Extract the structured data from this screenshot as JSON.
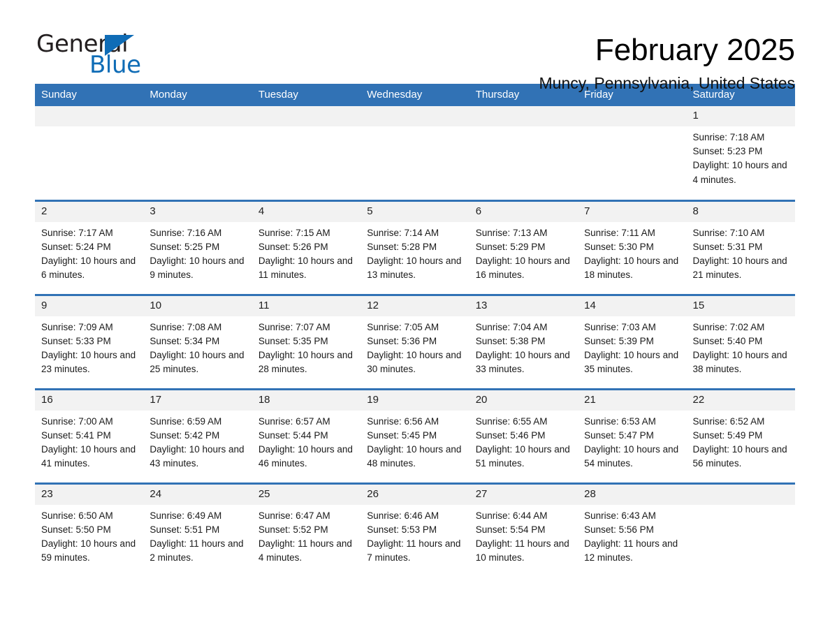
{
  "brand": {
    "name_part1": "General",
    "name_part2": "Blue",
    "accent_color": "#0f6cb6"
  },
  "header": {
    "month_title": "February 2025",
    "location": "Muncy, Pennsylvania, United States"
  },
  "theme": {
    "header_blue": "#3172b5",
    "daynum_band": "#f2f2f2",
    "text": "#1a1a1a"
  },
  "weekdays": [
    "Sunday",
    "Monday",
    "Tuesday",
    "Wednesday",
    "Thursday",
    "Friday",
    "Saturday"
  ],
  "labels": {
    "sunrise": "Sunrise:",
    "sunset": "Sunset:",
    "daylight": "Daylight:"
  },
  "weeks": [
    [
      {
        "day": ""
      },
      {
        "day": ""
      },
      {
        "day": ""
      },
      {
        "day": ""
      },
      {
        "day": ""
      },
      {
        "day": ""
      },
      {
        "day": "1",
        "sunrise": "Sunrise: 7:18 AM",
        "sunset": "Sunset: 5:23 PM",
        "daylight": "Daylight: 10 hours and 4 minutes."
      }
    ],
    [
      {
        "day": "2",
        "sunrise": "Sunrise: 7:17 AM",
        "sunset": "Sunset: 5:24 PM",
        "daylight": "Daylight: 10 hours and 6 minutes."
      },
      {
        "day": "3",
        "sunrise": "Sunrise: 7:16 AM",
        "sunset": "Sunset: 5:25 PM",
        "daylight": "Daylight: 10 hours and 9 minutes."
      },
      {
        "day": "4",
        "sunrise": "Sunrise: 7:15 AM",
        "sunset": "Sunset: 5:26 PM",
        "daylight": "Daylight: 10 hours and 11 minutes."
      },
      {
        "day": "5",
        "sunrise": "Sunrise: 7:14 AM",
        "sunset": "Sunset: 5:28 PM",
        "daylight": "Daylight: 10 hours and 13 minutes."
      },
      {
        "day": "6",
        "sunrise": "Sunrise: 7:13 AM",
        "sunset": "Sunset: 5:29 PM",
        "daylight": "Daylight: 10 hours and 16 minutes."
      },
      {
        "day": "7",
        "sunrise": "Sunrise: 7:11 AM",
        "sunset": "Sunset: 5:30 PM",
        "daylight": "Daylight: 10 hours and 18 minutes."
      },
      {
        "day": "8",
        "sunrise": "Sunrise: 7:10 AM",
        "sunset": "Sunset: 5:31 PM",
        "daylight": "Daylight: 10 hours and 21 minutes."
      }
    ],
    [
      {
        "day": "9",
        "sunrise": "Sunrise: 7:09 AM",
        "sunset": "Sunset: 5:33 PM",
        "daylight": "Daylight: 10 hours and 23 minutes."
      },
      {
        "day": "10",
        "sunrise": "Sunrise: 7:08 AM",
        "sunset": "Sunset: 5:34 PM",
        "daylight": "Daylight: 10 hours and 25 minutes."
      },
      {
        "day": "11",
        "sunrise": "Sunrise: 7:07 AM",
        "sunset": "Sunset: 5:35 PM",
        "daylight": "Daylight: 10 hours and 28 minutes."
      },
      {
        "day": "12",
        "sunrise": "Sunrise: 7:05 AM",
        "sunset": "Sunset: 5:36 PM",
        "daylight": "Daylight: 10 hours and 30 minutes."
      },
      {
        "day": "13",
        "sunrise": "Sunrise: 7:04 AM",
        "sunset": "Sunset: 5:38 PM",
        "daylight": "Daylight: 10 hours and 33 minutes."
      },
      {
        "day": "14",
        "sunrise": "Sunrise: 7:03 AM",
        "sunset": "Sunset: 5:39 PM",
        "daylight": "Daylight: 10 hours and 35 minutes."
      },
      {
        "day": "15",
        "sunrise": "Sunrise: 7:02 AM",
        "sunset": "Sunset: 5:40 PM",
        "daylight": "Daylight: 10 hours and 38 minutes."
      }
    ],
    [
      {
        "day": "16",
        "sunrise": "Sunrise: 7:00 AM",
        "sunset": "Sunset: 5:41 PM",
        "daylight": "Daylight: 10 hours and 41 minutes."
      },
      {
        "day": "17",
        "sunrise": "Sunrise: 6:59 AM",
        "sunset": "Sunset: 5:42 PM",
        "daylight": "Daylight: 10 hours and 43 minutes."
      },
      {
        "day": "18",
        "sunrise": "Sunrise: 6:57 AM",
        "sunset": "Sunset: 5:44 PM",
        "daylight": "Daylight: 10 hours and 46 minutes."
      },
      {
        "day": "19",
        "sunrise": "Sunrise: 6:56 AM",
        "sunset": "Sunset: 5:45 PM",
        "daylight": "Daylight: 10 hours and 48 minutes."
      },
      {
        "day": "20",
        "sunrise": "Sunrise: 6:55 AM",
        "sunset": "Sunset: 5:46 PM",
        "daylight": "Daylight: 10 hours and 51 minutes."
      },
      {
        "day": "21",
        "sunrise": "Sunrise: 6:53 AM",
        "sunset": "Sunset: 5:47 PM",
        "daylight": "Daylight: 10 hours and 54 minutes."
      },
      {
        "day": "22",
        "sunrise": "Sunrise: 6:52 AM",
        "sunset": "Sunset: 5:49 PM",
        "daylight": "Daylight: 10 hours and 56 minutes."
      }
    ],
    [
      {
        "day": "23",
        "sunrise": "Sunrise: 6:50 AM",
        "sunset": "Sunset: 5:50 PM",
        "daylight": "Daylight: 10 hours and 59 minutes."
      },
      {
        "day": "24",
        "sunrise": "Sunrise: 6:49 AM",
        "sunset": "Sunset: 5:51 PM",
        "daylight": "Daylight: 11 hours and 2 minutes."
      },
      {
        "day": "25",
        "sunrise": "Sunrise: 6:47 AM",
        "sunset": "Sunset: 5:52 PM",
        "daylight": "Daylight: 11 hours and 4 minutes."
      },
      {
        "day": "26",
        "sunrise": "Sunrise: 6:46 AM",
        "sunset": "Sunset: 5:53 PM",
        "daylight": "Daylight: 11 hours and 7 minutes."
      },
      {
        "day": "27",
        "sunrise": "Sunrise: 6:44 AM",
        "sunset": "Sunset: 5:54 PM",
        "daylight": "Daylight: 11 hours and 10 minutes."
      },
      {
        "day": "28",
        "sunrise": "Sunrise: 6:43 AM",
        "sunset": "Sunset: 5:56 PM",
        "daylight": "Daylight: 11 hours and 12 minutes."
      },
      {
        "day": ""
      }
    ]
  ]
}
